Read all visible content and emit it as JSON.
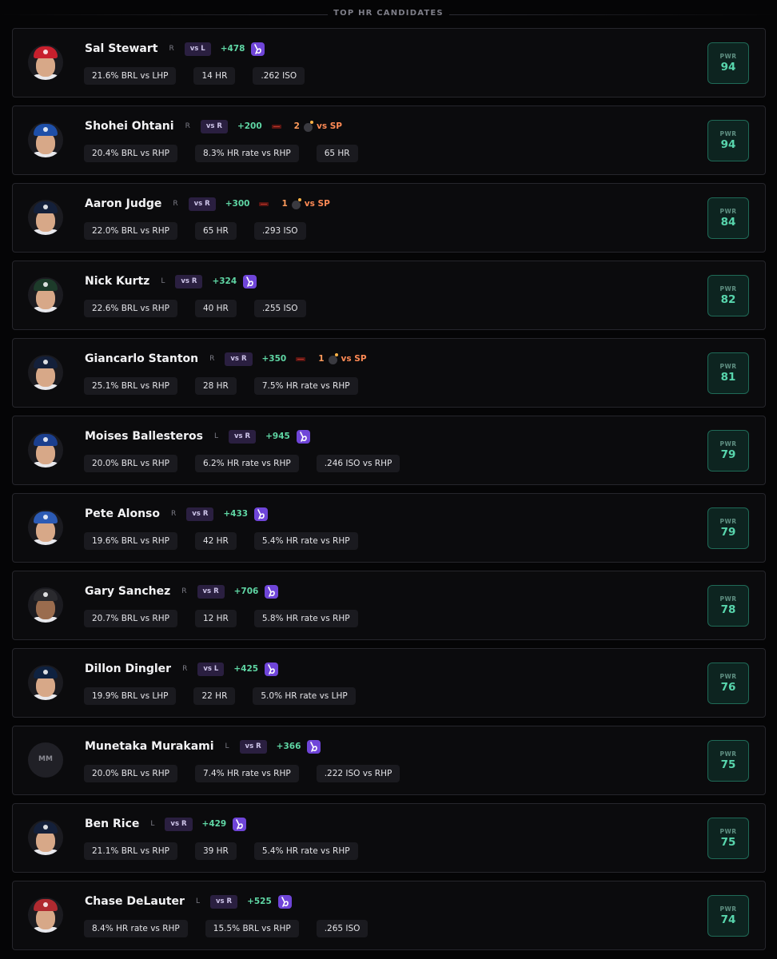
{
  "header": {
    "title": "TOP HR CANDIDATES"
  },
  "players": [
    {
      "name": "Sal Stewart",
      "hand": "R",
      "matchup": "vs L",
      "odds": "+478",
      "avatar": "headshot",
      "cap": "#c8202d",
      "skin": "light",
      "history": null,
      "stats": [
        "21.6% BRL vs LHP",
        "14 HR",
        ".262 ISO"
      ],
      "pwr_label": "PWR",
      "pwr": "94"
    },
    {
      "name": "Shohei Ohtani",
      "hand": "R",
      "matchup": "vs R",
      "odds": "+200",
      "avatar": "headshot",
      "cap": "#1e4fa8",
      "skin": "light",
      "history": {
        "count": "2",
        "label": "vs SP"
      },
      "stats": [
        "20.4% BRL vs RHP",
        "8.3% HR rate vs RHP",
        "65 HR"
      ],
      "pwr_label": "PWR",
      "pwr": "94"
    },
    {
      "name": "Aaron Judge",
      "hand": "R",
      "matchup": "vs R",
      "odds": "+300",
      "avatar": "headshot",
      "cap": "#14203a",
      "skin": "light",
      "history": {
        "count": "1",
        "label": "vs SP"
      },
      "stats": [
        "22.0% BRL vs RHP",
        "65 HR",
        ".293 ISO"
      ],
      "pwr_label": "PWR",
      "pwr": "84"
    },
    {
      "name": "Nick Kurtz",
      "hand": "L",
      "matchup": "vs R",
      "odds": "+324",
      "avatar": "headshot",
      "cap": "#1d3b2a",
      "skin": "light",
      "history": null,
      "stats": [
        "22.6% BRL vs RHP",
        "40 HR",
        ".255 ISO"
      ],
      "pwr_label": "PWR",
      "pwr": "82"
    },
    {
      "name": "Giancarlo Stanton",
      "hand": "R",
      "matchup": "vs R",
      "odds": "+350",
      "avatar": "headshot",
      "cap": "#14203a",
      "skin": "light",
      "history": {
        "count": "1",
        "label": "vs SP"
      },
      "stats": [
        "25.1% BRL vs RHP",
        "28 HR",
        "7.5% HR rate vs RHP"
      ],
      "pwr_label": "PWR",
      "pwr": "81"
    },
    {
      "name": "Moises Ballesteros",
      "hand": "L",
      "matchup": "vs R",
      "odds": "+945",
      "avatar": "headshot",
      "cap": "#1b3f8e",
      "skin": "light",
      "history": null,
      "stats": [
        "20.0% BRL vs RHP",
        "6.2% HR rate vs RHP",
        ".246 ISO vs RHP"
      ],
      "pwr_label": "PWR",
      "pwr": "79"
    },
    {
      "name": "Pete Alonso",
      "hand": "R",
      "matchup": "vs R",
      "odds": "+433",
      "avatar": "headshot",
      "cap": "#2c5bb5",
      "skin": "light",
      "history": null,
      "stats": [
        "19.6% BRL vs RHP",
        "42 HR",
        "5.4% HR rate vs RHP"
      ],
      "pwr_label": "PWR",
      "pwr": "79"
    },
    {
      "name": "Gary Sanchez",
      "hand": "R",
      "matchup": "vs R",
      "odds": "+706",
      "avatar": "headshot",
      "cap": "#2a2a2e",
      "skin": "dark",
      "history": null,
      "stats": [
        "20.7% BRL vs RHP",
        "12 HR",
        "5.8% HR rate vs RHP"
      ],
      "pwr_label": "PWR",
      "pwr": "78"
    },
    {
      "name": "Dillon Dingler",
      "hand": "R",
      "matchup": "vs L",
      "odds": "+425",
      "avatar": "headshot",
      "cap": "#0f2240",
      "skin": "light",
      "history": null,
      "stats": [
        "19.9% BRL vs LHP",
        "22 HR",
        "5.0% HR rate vs LHP"
      ],
      "pwr_label": "PWR",
      "pwr": "76"
    },
    {
      "name": "Munetaka Murakami",
      "hand": "L",
      "matchup": "vs R",
      "odds": "+366",
      "avatar": "initials",
      "initials": "MM",
      "history": null,
      "stats": [
        "20.0% BRL vs RHP",
        "7.4% HR rate vs RHP",
        ".222 ISO vs RHP"
      ],
      "pwr_label": "PWR",
      "pwr": "75"
    },
    {
      "name": "Ben Rice",
      "hand": "L",
      "matchup": "vs R",
      "odds": "+429",
      "avatar": "headshot",
      "cap": "#14203a",
      "skin": "light",
      "history": null,
      "stats": [
        "21.1% BRL vs RHP",
        "39 HR",
        "5.4% HR rate vs RHP"
      ],
      "pwr_label": "PWR",
      "pwr": "75"
    },
    {
      "name": "Chase DeLauter",
      "hand": "L",
      "matchup": "vs R",
      "odds": "+525",
      "avatar": "headshot",
      "cap": "#b02a30",
      "skin": "light",
      "history": null,
      "stats": [
        "8.4% HR rate vs RHP",
        "15.5% BRL vs RHP",
        ".265 ISO"
      ],
      "pwr_label": "PWR",
      "pwr": "74"
    }
  ],
  "colors": {
    "accent": "#58d6ad",
    "odds": "#5fd6a4",
    "history": "#ff8a55",
    "book": "#6f45d8",
    "matchup_bg": "#2a1f40"
  },
  "icons": {
    "book": "sportsbook-logo-icon",
    "history": "bomb-icon",
    "team": "team-logo-icon"
  }
}
